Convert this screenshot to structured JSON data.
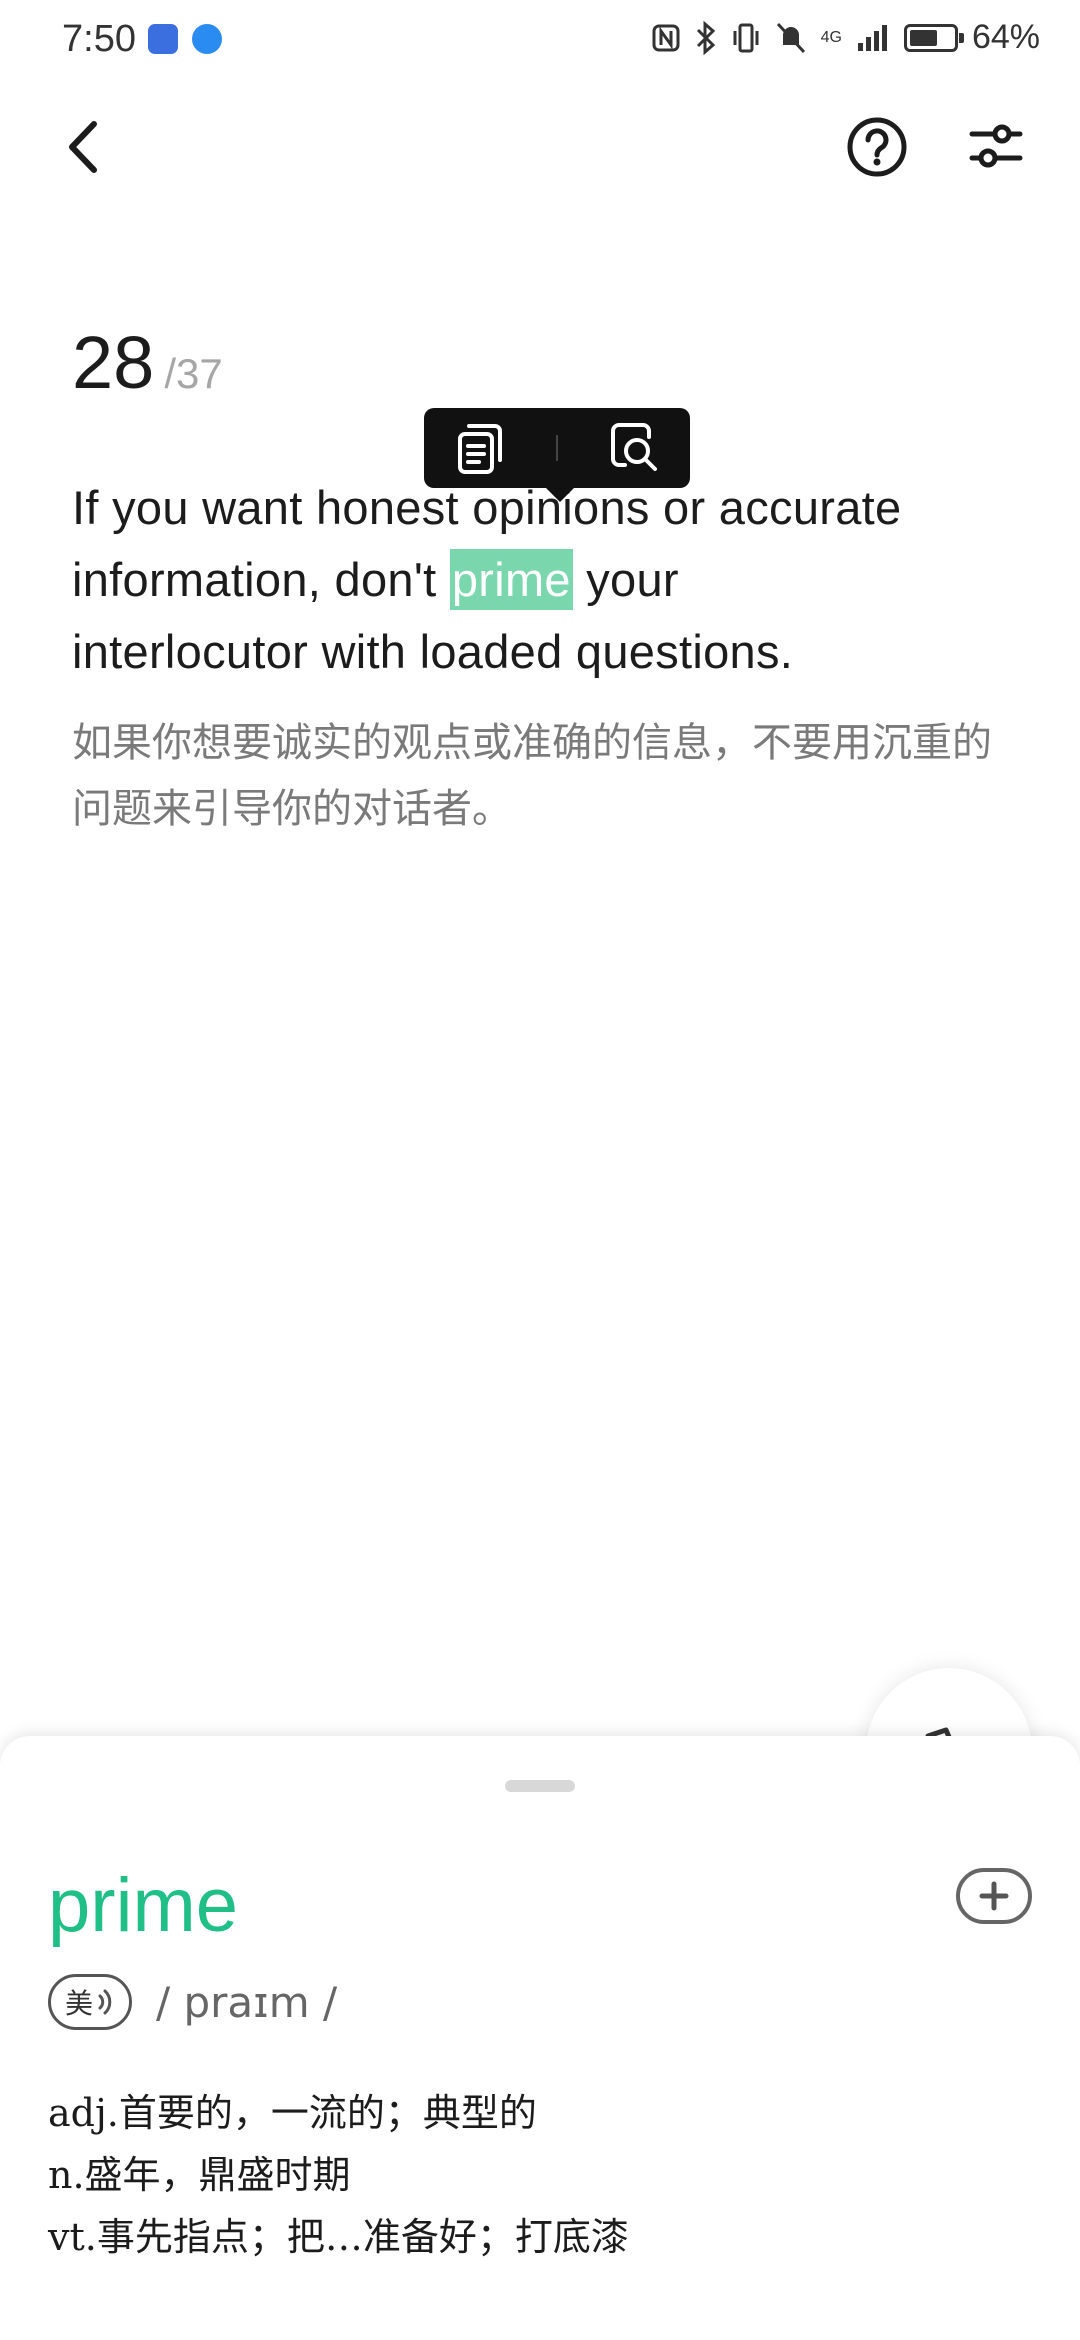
{
  "status_bar": {
    "time": "7:50",
    "battery": "64%",
    "battery_level": 0.64,
    "network": "4G"
  },
  "header": {
    "back_icon": "chevron-left-icon",
    "help_icon": "question-circle-icon",
    "settings_icon": "sliders-icon"
  },
  "counter": {
    "current": "28",
    "total": "/37"
  },
  "sentence": {
    "line1": "If you want honest opinions or accurate",
    "line2_before": "information, don't ",
    "highlighted_word": "prime",
    "line2_after": " your",
    "line3": "interlocutor with loaded questions.",
    "translation": "如果你想要诚实的观点或准确的信息，不要用沉重的问题来引导你的对话者。"
  },
  "popup": {
    "copy_icon": "copy-icon",
    "lookup_icon": "search-document-icon"
  },
  "word_card": {
    "word": "prime",
    "accent_label": "美",
    "phonetic": "/ praɪm /",
    "definitions": [
      "adj.首要的，一流的；典型的",
      "n.盛年，鼎盛时期",
      "vt.事先指点；把…准备好；打底漆"
    ],
    "add_icon": "plus-circle-icon"
  },
  "colors": {
    "accent": "#1fbf87",
    "highlight": "#7ad6ad",
    "popup_bg": "#111111"
  }
}
